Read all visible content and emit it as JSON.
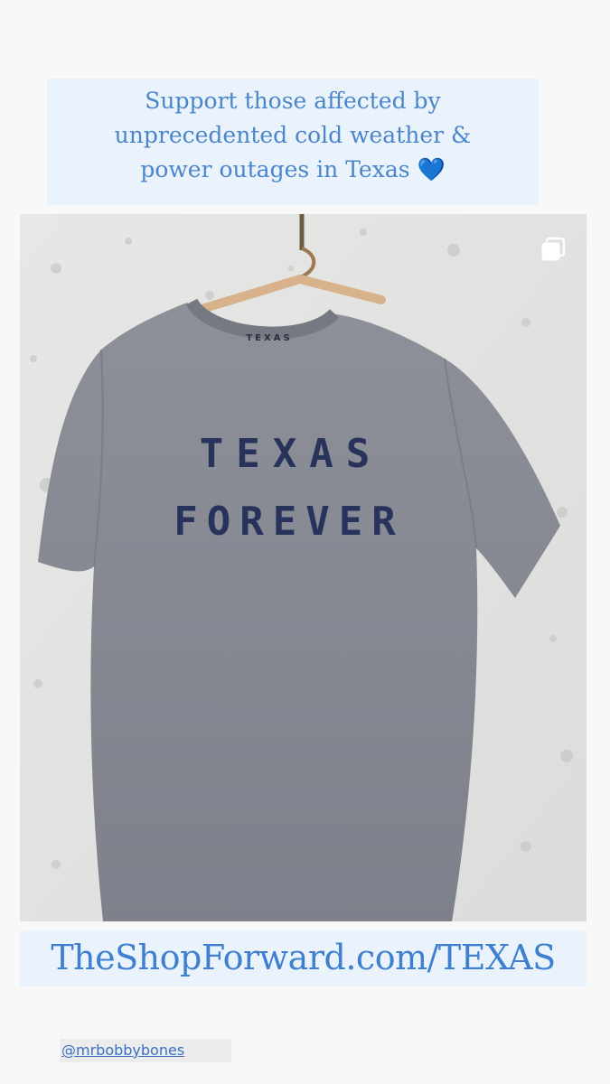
{
  "caption": {
    "line1": "Support those affected by",
    "line2": "unprecedented cold weather &",
    "line3": "power outages in Texas",
    "emoji": "💙"
  },
  "photo": {
    "shirt_text_line1": "TEXAS",
    "shirt_text_line2": "FOREVER",
    "neck_label": "TEXAS",
    "icon": "multiple-photos-icon"
  },
  "link": {
    "text": "TheShopForward.com/TEXAS"
  },
  "mention": {
    "text": "@mrbobbybones"
  },
  "colors": {
    "caption_bg": "#eaf3fb",
    "caption_text": "#4a86c9",
    "link_text": "#3f7fd0",
    "shirt": "#8a8d96",
    "shirt_print": "#27335a"
  }
}
